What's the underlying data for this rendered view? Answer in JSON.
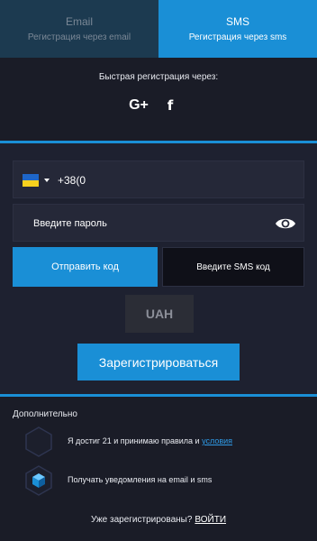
{
  "tabs": [
    {
      "title": "Email",
      "subtitle": "Регистрация через email",
      "active": false
    },
    {
      "title": "SMS",
      "subtitle": "Регистрация через sms",
      "active": true
    }
  ],
  "quick_register": {
    "title": "Быстрая регистрация через:",
    "google_label": "G+",
    "facebook_label": "f"
  },
  "phone": {
    "country_flag": "ukraine-flag",
    "value": "+38(0"
  },
  "password": {
    "placeholder": "Введите пароль",
    "eye_icon": "eye-icon"
  },
  "sms": {
    "send_code_label": "Отправить код",
    "code_placeholder": "Введите SMS код"
  },
  "currency": "UAH",
  "register_label": "Зарегистрироваться",
  "additional": {
    "title": "Дополнительно",
    "age_text": "Я достиг 21 и принимаю правила и",
    "terms_link": "условия",
    "age_checked": false,
    "notify_text": "Получать уведомления на email и sms",
    "notify_checked": true
  },
  "footer": {
    "question": "Уже зарегистрированы?",
    "login_link": "ВОЙТИ"
  },
  "colors": {
    "accent": "#1a8fd6",
    "background": "#1e2130",
    "panel": "#1a1c27",
    "field": "#252838"
  }
}
